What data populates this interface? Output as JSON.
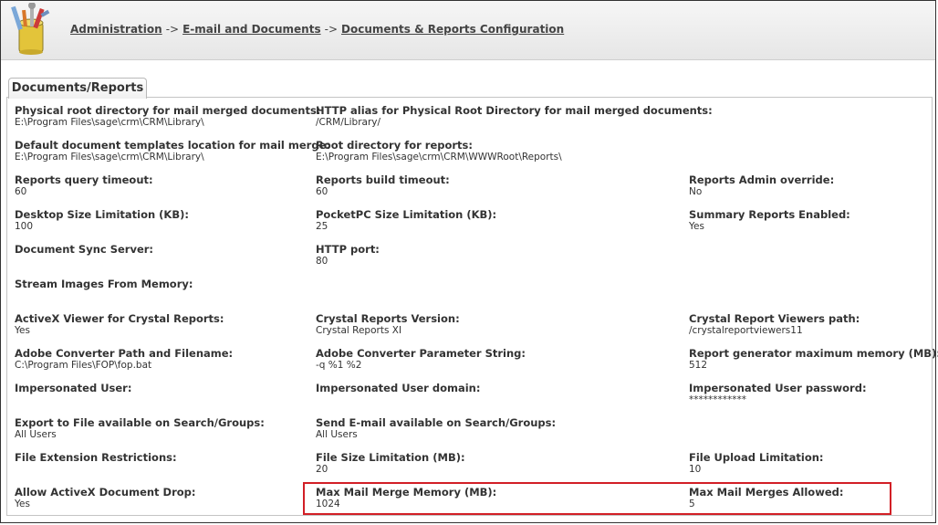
{
  "breadcrumb": {
    "items": [
      "Administration",
      "E-mail and Documents",
      "Documents & Reports Configuration"
    ],
    "separator": "->"
  },
  "tab": {
    "label": "Documents/Reports"
  },
  "fields": {
    "r1": [
      {
        "label": "Physical root directory for mail merged documents:",
        "value": "E:\\Program Files\\sage\\crm\\CRM\\Library\\"
      },
      {
        "label": "HTTP alias for Physical Root Directory for mail merged documents:",
        "value": "/CRM/Library/"
      }
    ],
    "r2": [
      {
        "label": "Default document templates location for mail merge:",
        "value": "E:\\Program Files\\sage\\crm\\CRM\\Library\\"
      },
      {
        "label": "Root directory for reports:",
        "value": "E:\\Program Files\\sage\\crm\\CRM\\WWWRoot\\Reports\\"
      }
    ],
    "r3": [
      {
        "label": "Reports query timeout:",
        "value": "60"
      },
      {
        "label": "Reports build timeout:",
        "value": "60"
      },
      {
        "label": "Reports Admin override:",
        "value": "No"
      }
    ],
    "r4": [
      {
        "label": "Desktop Size Limitation (KB):",
        "value": "100"
      },
      {
        "label": "PocketPC Size Limitation (KB):",
        "value": "25"
      },
      {
        "label": "Summary Reports Enabled:",
        "value": "Yes"
      }
    ],
    "r5": [
      {
        "label": "Document Sync Server:",
        "value": ""
      },
      {
        "label": "HTTP port:",
        "value": "80"
      }
    ],
    "r6": [
      {
        "label": "Stream Images From Memory:",
        "value": ""
      }
    ],
    "r7": [
      {
        "label": "ActiveX Viewer for Crystal Reports:",
        "value": "Yes"
      },
      {
        "label": "Crystal Reports Version:",
        "value": "Crystal Reports XI"
      },
      {
        "label": "Crystal Report Viewers path:",
        "value": "/crystalreportviewers11"
      }
    ],
    "r8": [
      {
        "label": "Adobe Converter Path and Filename:",
        "value": "C:\\Program Files\\FOP\\fop.bat"
      },
      {
        "label": "Adobe Converter Parameter String:",
        "value": "-q %1 %2"
      },
      {
        "label": "Report generator maximum memory (MB):",
        "value": "512"
      }
    ],
    "r9": [
      {
        "label": "Impersonated User:",
        "value": ""
      },
      {
        "label": "Impersonated User domain:",
        "value": ""
      },
      {
        "label": "Impersonated User password:",
        "value": "************"
      }
    ],
    "r10": [
      {
        "label": "Export to File available on Search/Groups:",
        "value": "All Users"
      },
      {
        "label": "Send E-mail available on Search/Groups:",
        "value": "All Users"
      }
    ],
    "r11": [
      {
        "label": "File Extension Restrictions:",
        "value": ""
      },
      {
        "label": "File Size Limitation (MB):",
        "value": "20"
      },
      {
        "label": "File Upload Limitation:",
        "value": "10"
      }
    ],
    "r12": [
      {
        "label": "Allow ActiveX Document Drop:",
        "value": "Yes"
      },
      {
        "label": "Max Mail Merge Memory (MB):",
        "value": "1024"
      },
      {
        "label": "Max Mail Merges Allowed:",
        "value": "5"
      }
    ]
  },
  "colors": {
    "highlight": "#d21f26",
    "topbar": "#ececec"
  }
}
